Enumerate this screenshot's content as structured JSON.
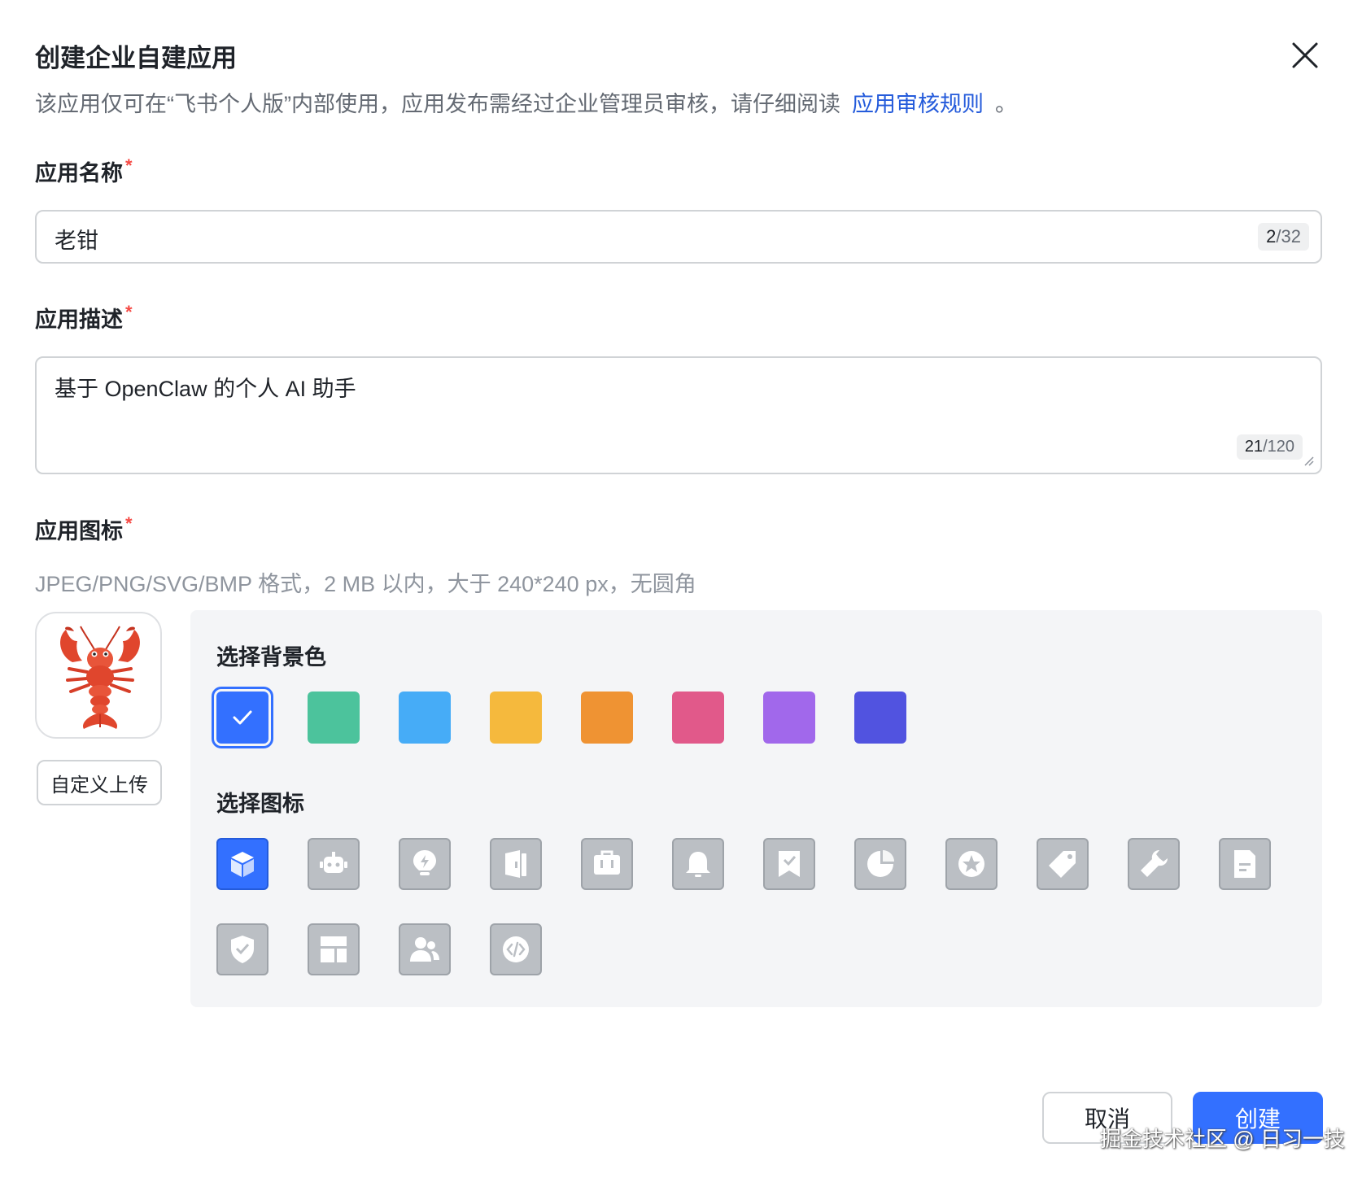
{
  "dialog": {
    "title": "创建企业自建应用",
    "desc_text": "该应用仅可在“飞书个人版”内部使用，应用发布需经过企业管理员审核，请仔细阅读",
    "desc_link": "应用审核规则",
    "desc_end": "。"
  },
  "name_field": {
    "label": "应用名称",
    "required": "*",
    "value": "老钳",
    "count_current": "2",
    "count_max": "/32"
  },
  "desc_field": {
    "label": "应用描述",
    "required": "*",
    "value": "基于 OpenClaw 的个人 AI 助手",
    "count_current": "21",
    "count_max": "/120"
  },
  "icon_field": {
    "label": "应用图标",
    "required": "*",
    "hint": "JPEG/PNG/SVG/BMP 格式，2 MB 以内，大于 240*240 px，无圆角",
    "preview_icon": "lobster-emoji-icon",
    "upload_label": "自定义上传"
  },
  "picker": {
    "bg_title": "选择背景色",
    "colors": [
      "#3370ff",
      "#4cc39c",
      "#46acf7",
      "#f5b93d",
      "#ef9333",
      "#e1598a",
      "#a168eb",
      "#5153e0"
    ],
    "selected_color": 0,
    "icon_title": "选择图标",
    "icons": [
      "cube-icon",
      "robot-icon",
      "lightbulb-icon",
      "book-icon",
      "briefcase-icon",
      "bell-icon",
      "bookmark-check-icon",
      "pie-chart-icon",
      "star-badge-icon",
      "tag-icon",
      "wrench-icon",
      "document-icon",
      "shield-check-icon",
      "layout-icon",
      "users-icon",
      "code-icon"
    ],
    "selected_icon": 0
  },
  "footer": {
    "cancel_label": "取消",
    "create_label": "创建"
  },
  "watermark": "掘金技术社区 @ 日习一技"
}
